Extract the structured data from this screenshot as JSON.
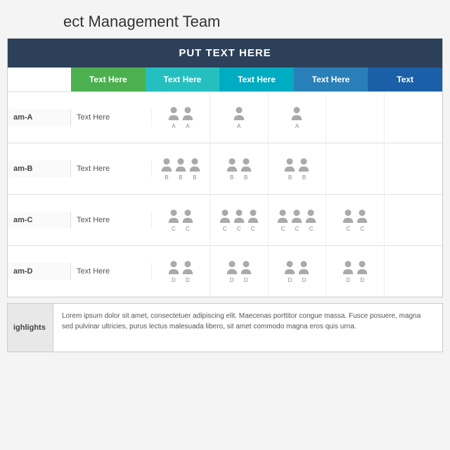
{
  "title": "ect Management Team",
  "header": {
    "text": "PUT TEXT HERE"
  },
  "col_headers": [
    {
      "label": "Text Here",
      "class": "col-header-0"
    },
    {
      "label": "Text Here",
      "class": "col-header-1"
    },
    {
      "label": "Text Here",
      "class": "col-header-2"
    },
    {
      "label": "Text Here",
      "class": "col-header-3"
    },
    {
      "label": "Text",
      "class": "col-header-4"
    }
  ],
  "rows": [
    {
      "label": "am-A",
      "text": "Text Here",
      "cells": [
        {
          "icons": [
            "A",
            "A"
          ],
          "count": 2
        },
        {
          "icons": [
            "A"
          ],
          "count": 1
        },
        {
          "icons": [
            "A"
          ],
          "count": 1
        },
        {
          "icons": [],
          "count": 0
        },
        {
          "icons": [],
          "count": 0
        }
      ]
    },
    {
      "label": "am-B",
      "text": "Text Here",
      "cells": [
        {
          "icons": [
            "B",
            "B",
            "B"
          ],
          "count": 3
        },
        {
          "icons": [
            "B",
            "B"
          ],
          "count": 2
        },
        {
          "icons": [
            "B",
            "B"
          ],
          "count": 2
        },
        {
          "icons": [],
          "count": 0
        },
        {
          "icons": [],
          "count": 0
        }
      ]
    },
    {
      "label": "am-C",
      "text": "Text Here",
      "cells": [
        {
          "icons": [
            "C",
            "C"
          ],
          "count": 2
        },
        {
          "icons": [
            "C",
            "C",
            "C"
          ],
          "count": 3
        },
        {
          "icons": [
            "C",
            "C",
            "C"
          ],
          "count": 3
        },
        {
          "icons": [
            "C",
            "C"
          ],
          "count": 2
        },
        {
          "icons": [],
          "count": 0
        }
      ]
    },
    {
      "label": "am-D",
      "text": "Text Here",
      "cells": [
        {
          "icons": [
            "D",
            "D"
          ],
          "count": 2
        },
        {
          "icons": [
            "D",
            "D"
          ],
          "count": 2
        },
        {
          "icons": [
            "D",
            "D"
          ],
          "count": 2
        },
        {
          "icons": [
            "D",
            "D"
          ],
          "count": 2
        },
        {
          "icons": [],
          "count": 0
        }
      ]
    }
  ],
  "highlights": {
    "label": "ighlights",
    "text": "Lorem ipsum dolor sit amet, consectetuer adipiscing elit. Maecenas porttitor congue massa. Fusce posuere, magna sed pulvinar ultricies, purus lectus malesuada libero, sit amet commodo magna eros quis urna."
  }
}
